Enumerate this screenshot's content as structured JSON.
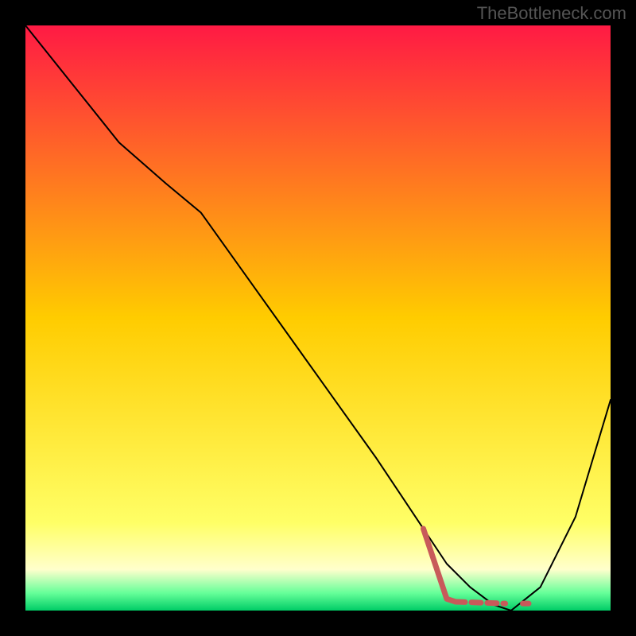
{
  "watermark": "TheBottleneck.com",
  "chart_data": {
    "type": "line",
    "title": "",
    "xlabel": "",
    "ylabel": "",
    "xlim": [
      0,
      100
    ],
    "ylim": [
      0,
      100
    ],
    "background_gradient": {
      "stops": [
        {
          "offset": 0,
          "color": "#ff1a44"
        },
        {
          "offset": 50,
          "color": "#ffcc00"
        },
        {
          "offset": 85,
          "color": "#ffff66"
        },
        {
          "offset": 93,
          "color": "#ffffcc"
        },
        {
          "offset": 97,
          "color": "#66ff99"
        },
        {
          "offset": 100,
          "color": "#00cc66"
        }
      ]
    },
    "series": [
      {
        "name": "curve",
        "color": "#000000",
        "stroke_width": 2,
        "x": [
          0,
          8,
          16,
          24,
          30,
          40,
          50,
          60,
          68,
          72,
          76,
          80,
          83,
          88,
          94,
          100
        ],
        "y": [
          100,
          90,
          80,
          73,
          68,
          54,
          40,
          26,
          14,
          8,
          4,
          1,
          0,
          4,
          16,
          36
        ]
      },
      {
        "name": "highlight",
        "color": "#c85a5a",
        "stroke_width": 7,
        "dash": null,
        "x": [
          68,
          72,
          73.5
        ],
        "y": [
          14,
          2,
          1.5
        ]
      },
      {
        "name": "highlight-flat",
        "color": "#c85a5a",
        "stroke_width": 7,
        "dash": "12 8",
        "x": [
          73.5,
          82
        ],
        "y": [
          1.5,
          1.2
        ]
      },
      {
        "name": "highlight-dot",
        "color": "#c85a5a",
        "stroke_width": 7,
        "dash": null,
        "x": [
          85,
          86
        ],
        "y": [
          1.2,
          1.2
        ]
      }
    ]
  }
}
